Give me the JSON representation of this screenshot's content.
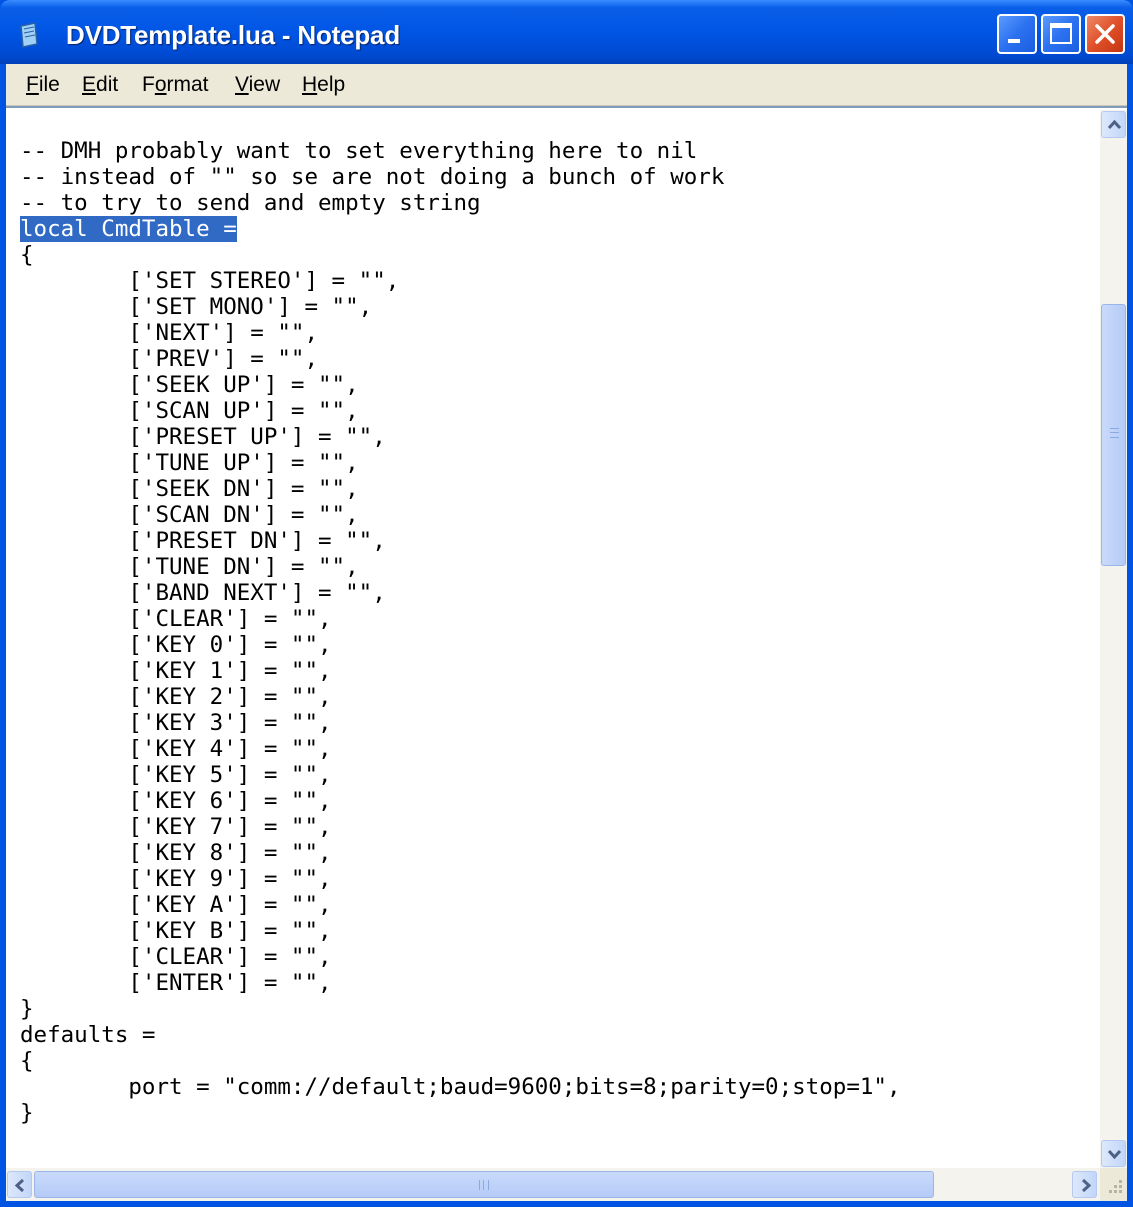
{
  "window": {
    "title": "DVDTemplate.lua - Notepad",
    "colors": {
      "titlebar": "#0054e3",
      "selection": "#316ac5",
      "menubar": "#ece9d8",
      "close_button": "#e0502a"
    }
  },
  "menu": [
    {
      "pre": "",
      "key": "F",
      "post": "ile"
    },
    {
      "pre": "",
      "key": "E",
      "post": "dit"
    },
    {
      "pre": "F",
      "key": "o",
      "post": "rmat"
    },
    {
      "pre": "",
      "key": "V",
      "post": "iew"
    },
    {
      "pre": "",
      "key": "H",
      "post": "elp"
    }
  ],
  "icons": {
    "app": "notepad-icon",
    "minimize": "minimize-icon",
    "maximize": "maximize-icon",
    "close": "close-icon",
    "scroll_up": "arrow-up-icon",
    "scroll_down": "arrow-down-icon",
    "scroll_left": "arrow-left-icon",
    "scroll_right": "arrow-right-icon"
  },
  "editor": {
    "selected_text": "local CmdTable =",
    "lines": [
      "-- DMH probably want to set everything here to nil",
      "-- instead of \"\" so se are not doing a bunch of work",
      "-- to try to send and empty string",
      "local CmdTable =",
      "{",
      "\t['SET STEREO'] = \"\",",
      "\t['SET MONO'] = \"\",",
      "\t['NEXT'] = \"\",",
      "\t['PREV'] = \"\",",
      "\t['SEEK UP'] = \"\",",
      "\t['SCAN UP'] = \"\",",
      "\t['PRESET UP'] = \"\",",
      "\t['TUNE UP'] = \"\",",
      "\t['SEEK DN'] = \"\",",
      "\t['SCAN DN'] = \"\",",
      "\t['PRESET DN'] = \"\",",
      "\t['TUNE DN'] = \"\",",
      "\t['BAND NEXT'] = \"\",",
      "\t['CLEAR'] = \"\",",
      "\t['KEY 0'] = \"\",",
      "\t['KEY 1'] = \"\",",
      "\t['KEY 2'] = \"\",",
      "\t['KEY 3'] = \"\",",
      "\t['KEY 4'] = \"\",",
      "\t['KEY 5'] = \"\",",
      "\t['KEY 6'] = \"\",",
      "\t['KEY 7'] = \"\",",
      "\t['KEY 8'] = \"\",",
      "\t['KEY 9'] = \"\",",
      "\t['KEY A'] = \"\",",
      "\t['KEY B'] = \"\",",
      "\t['CLEAR'] = \"\",",
      "\t['ENTER'] = \"\",",
      "}",
      "defaults =",
      "{",
      "\tport = \"comm://default;baud=9600;bits=8;parity=0;stop=1\",",
      "}"
    ]
  }
}
